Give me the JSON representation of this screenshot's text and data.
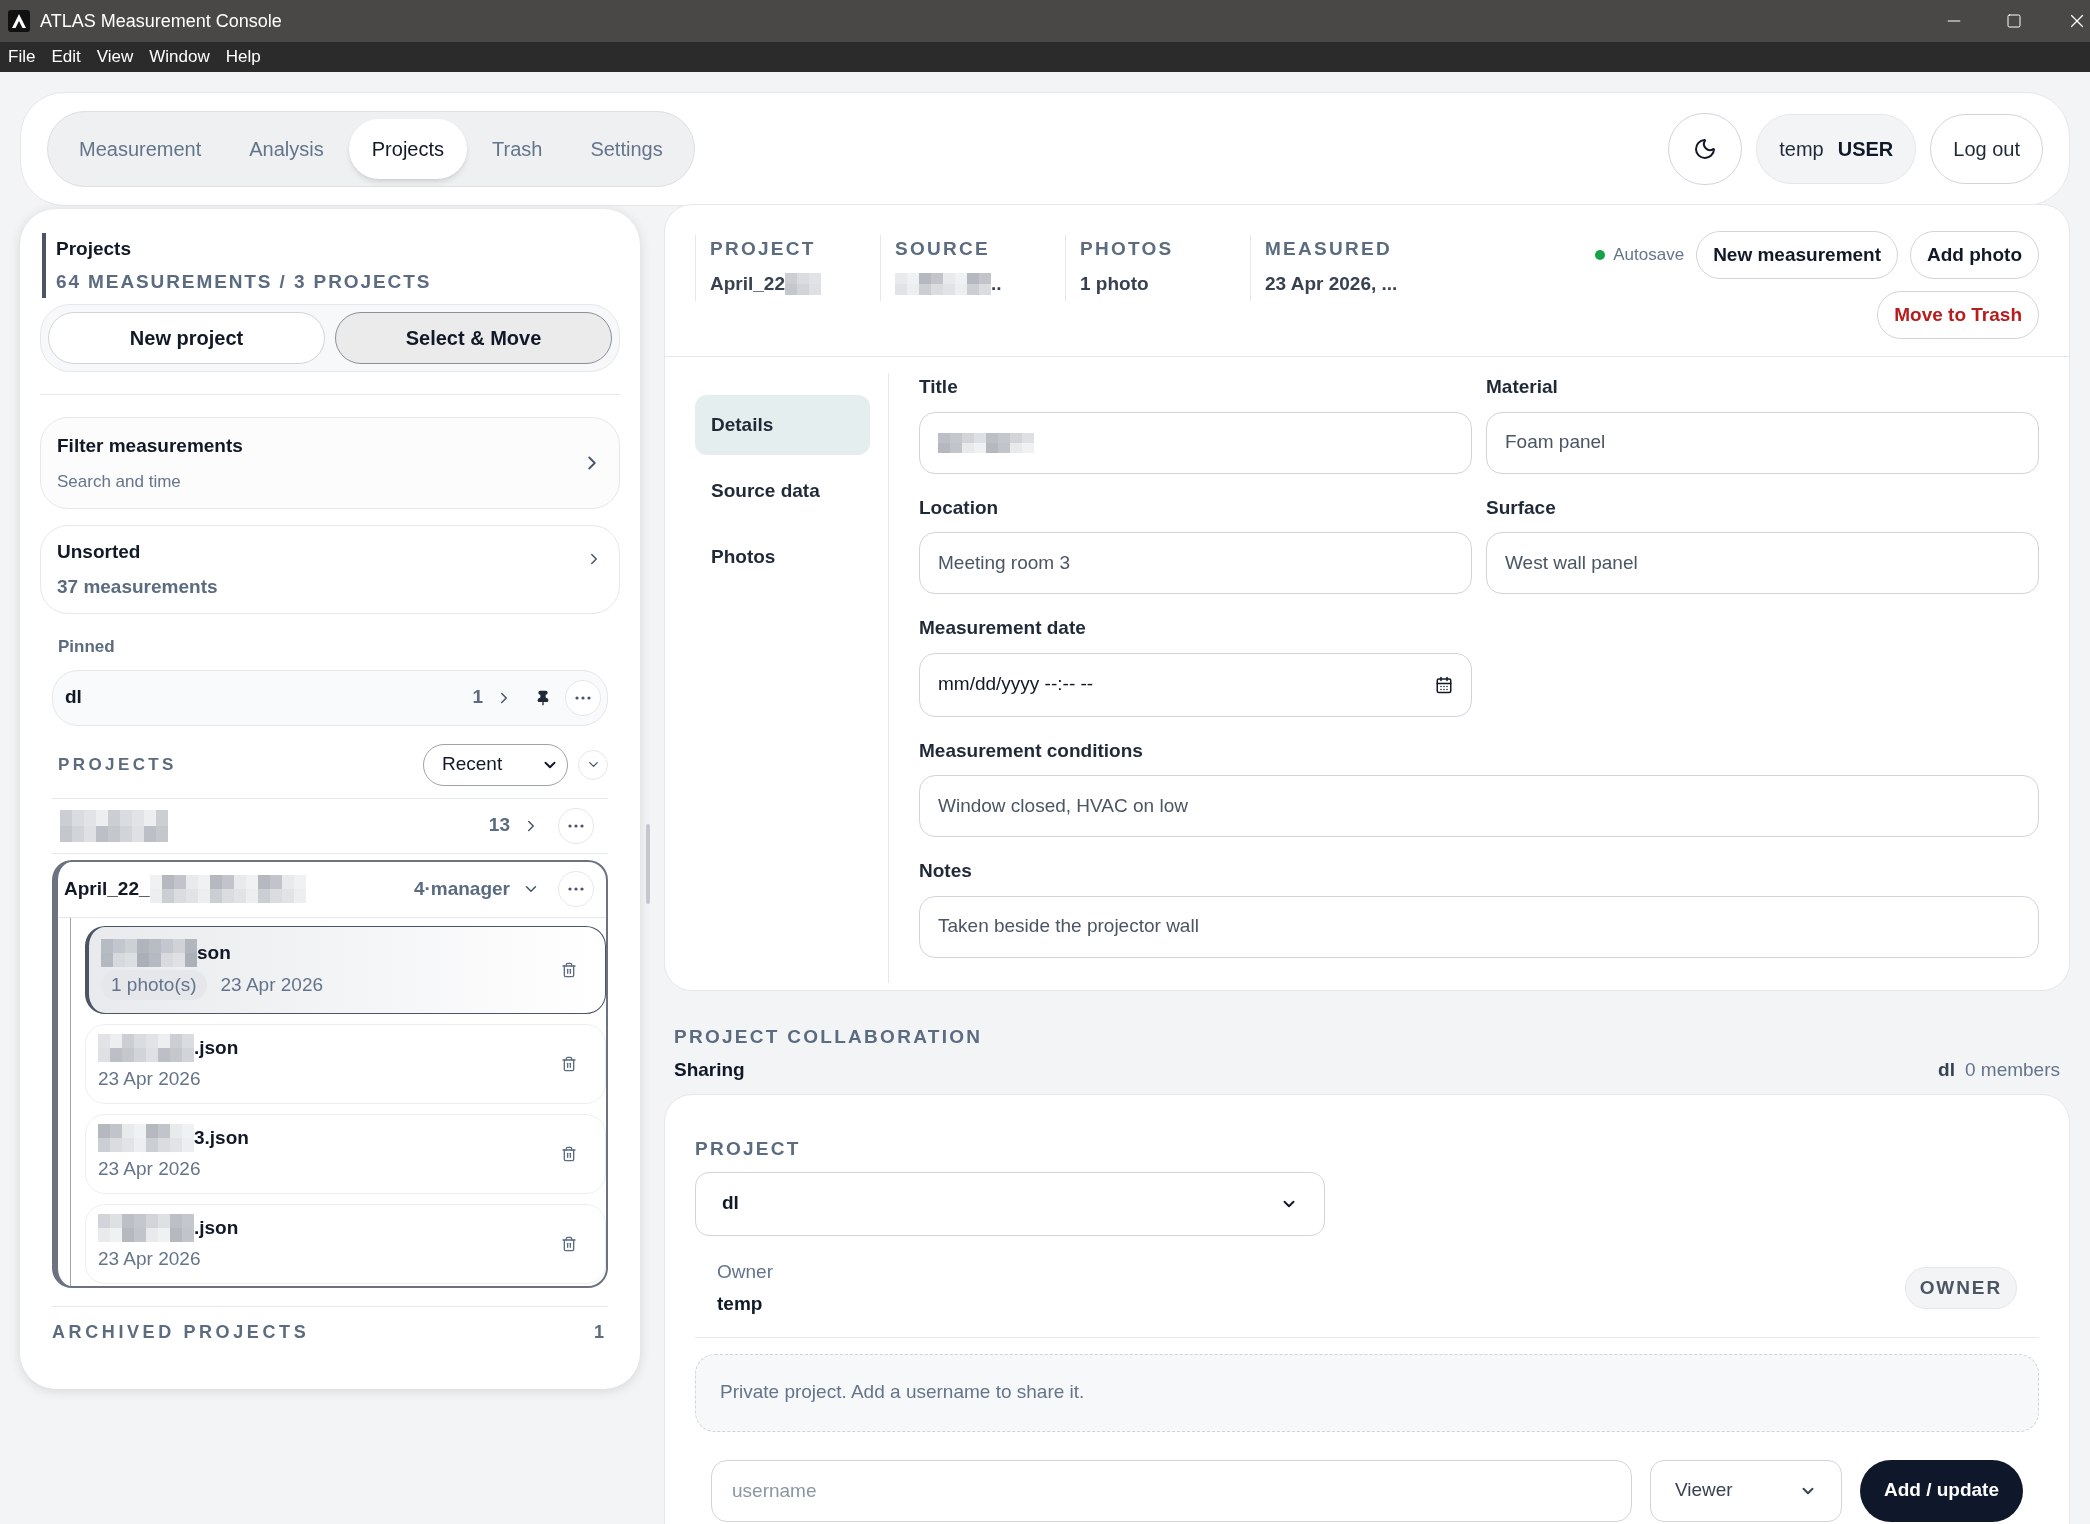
{
  "window": {
    "title": "ATLAS Measurement Console"
  },
  "menu": [
    "File",
    "Edit",
    "View",
    "Window",
    "Help"
  ],
  "nav": {
    "tabs": [
      {
        "label": "Measurement",
        "selected": false
      },
      {
        "label": "Analysis",
        "selected": false
      },
      {
        "label": "Projects",
        "selected": true
      },
      {
        "label": "Trash",
        "selected": false
      },
      {
        "label": "Settings",
        "selected": false
      }
    ],
    "user": {
      "name": "temp",
      "role": "USER"
    },
    "logout": "Log out"
  },
  "sidebar": {
    "title": "Projects",
    "summary": "64 MEASUREMENTS / 3 PROJECTS",
    "buttons": [
      {
        "label": "New project",
        "selected": false
      },
      {
        "label": "Select & Move",
        "selected": true
      }
    ],
    "filter": {
      "title": "Filter measurements",
      "subtitle": "Search and time"
    },
    "unsorted": {
      "title": "Unsorted",
      "count": "37 measurements"
    },
    "pinned_label": "Pinned",
    "pinned": [
      {
        "name": "dl",
        "count": "1",
        "pinned": true,
        "expanded": false
      }
    ],
    "projects_label": "PROJECTS",
    "sort": "Recent",
    "projects": [
      {
        "kind": "masked",
        "count": "13",
        "expanded": false
      },
      {
        "kind": "named",
        "name": "April_22_",
        "meta": "4·manager",
        "expanded": true,
        "measurements": [
          {
            "name": "son",
            "photos": "1 photo(s)",
            "date": "23 Apr 2026",
            "selected": true
          },
          {
            "name": ".json",
            "date": "23 Apr 2026",
            "selected": false
          },
          {
            "name": "3.json",
            "date": "23 Apr 2026",
            "selected": false
          },
          {
            "name": ".json",
            "date": "23 Apr 2026",
            "selected": false
          }
        ]
      }
    ],
    "archived": {
      "label": "ARCHIVED PROJECTS",
      "count": "1"
    }
  },
  "detail": {
    "summary": [
      {
        "label": "PROJECT",
        "value": "April_22",
        "kind": "masked_tail"
      },
      {
        "label": "SOURCE",
        "value": "..",
        "kind": "masked_head"
      },
      {
        "label": "PHOTOS",
        "value": "1 photo",
        "kind": "plain"
      },
      {
        "label": "MEASURED",
        "value": "23 Apr 2026, ...",
        "kind": "plain"
      }
    ],
    "status": {
      "label": "Autosave",
      "color": "#16a34a"
    },
    "actions": [
      {
        "label": "New measurement",
        "kind": "default"
      },
      {
        "label": "Add photo",
        "kind": "default"
      },
      {
        "label": "Move to Trash",
        "kind": "danger"
      }
    ],
    "sections": [
      {
        "label": "Details",
        "selected": true
      },
      {
        "label": "Source data",
        "selected": false
      },
      {
        "label": "Photos",
        "selected": false
      }
    ],
    "fields": [
      {
        "label": "Title",
        "kind": "masked"
      },
      {
        "label": "Material",
        "kind": "text",
        "value": "Foam panel"
      },
      {
        "label": "Location",
        "kind": "text",
        "value": "Meeting room 3"
      },
      {
        "label": "Surface",
        "kind": "text",
        "value": "West wall panel"
      },
      {
        "label": "Measurement date",
        "kind": "date",
        "value": "mm/dd/yyyy --:-- --"
      },
      {
        "label": "Measurement conditions",
        "kind": "wide",
        "value": "Window closed, HVAC on low"
      },
      {
        "label": "Notes",
        "kind": "wide",
        "value": "Taken beside the projector wall"
      }
    ]
  },
  "collaboration": {
    "label": "PROJECT COLLABORATION",
    "title": "Sharing",
    "project": "dl",
    "members": "0 members",
    "project_label": "PROJECT",
    "select": "dl",
    "owner_label": "Owner",
    "owner": "temp",
    "owner_badge": "OWNER",
    "notice": "Private project. Add a username to share it.",
    "username_placeholder": "username",
    "role": "Viewer",
    "submit": "Add / update"
  }
}
